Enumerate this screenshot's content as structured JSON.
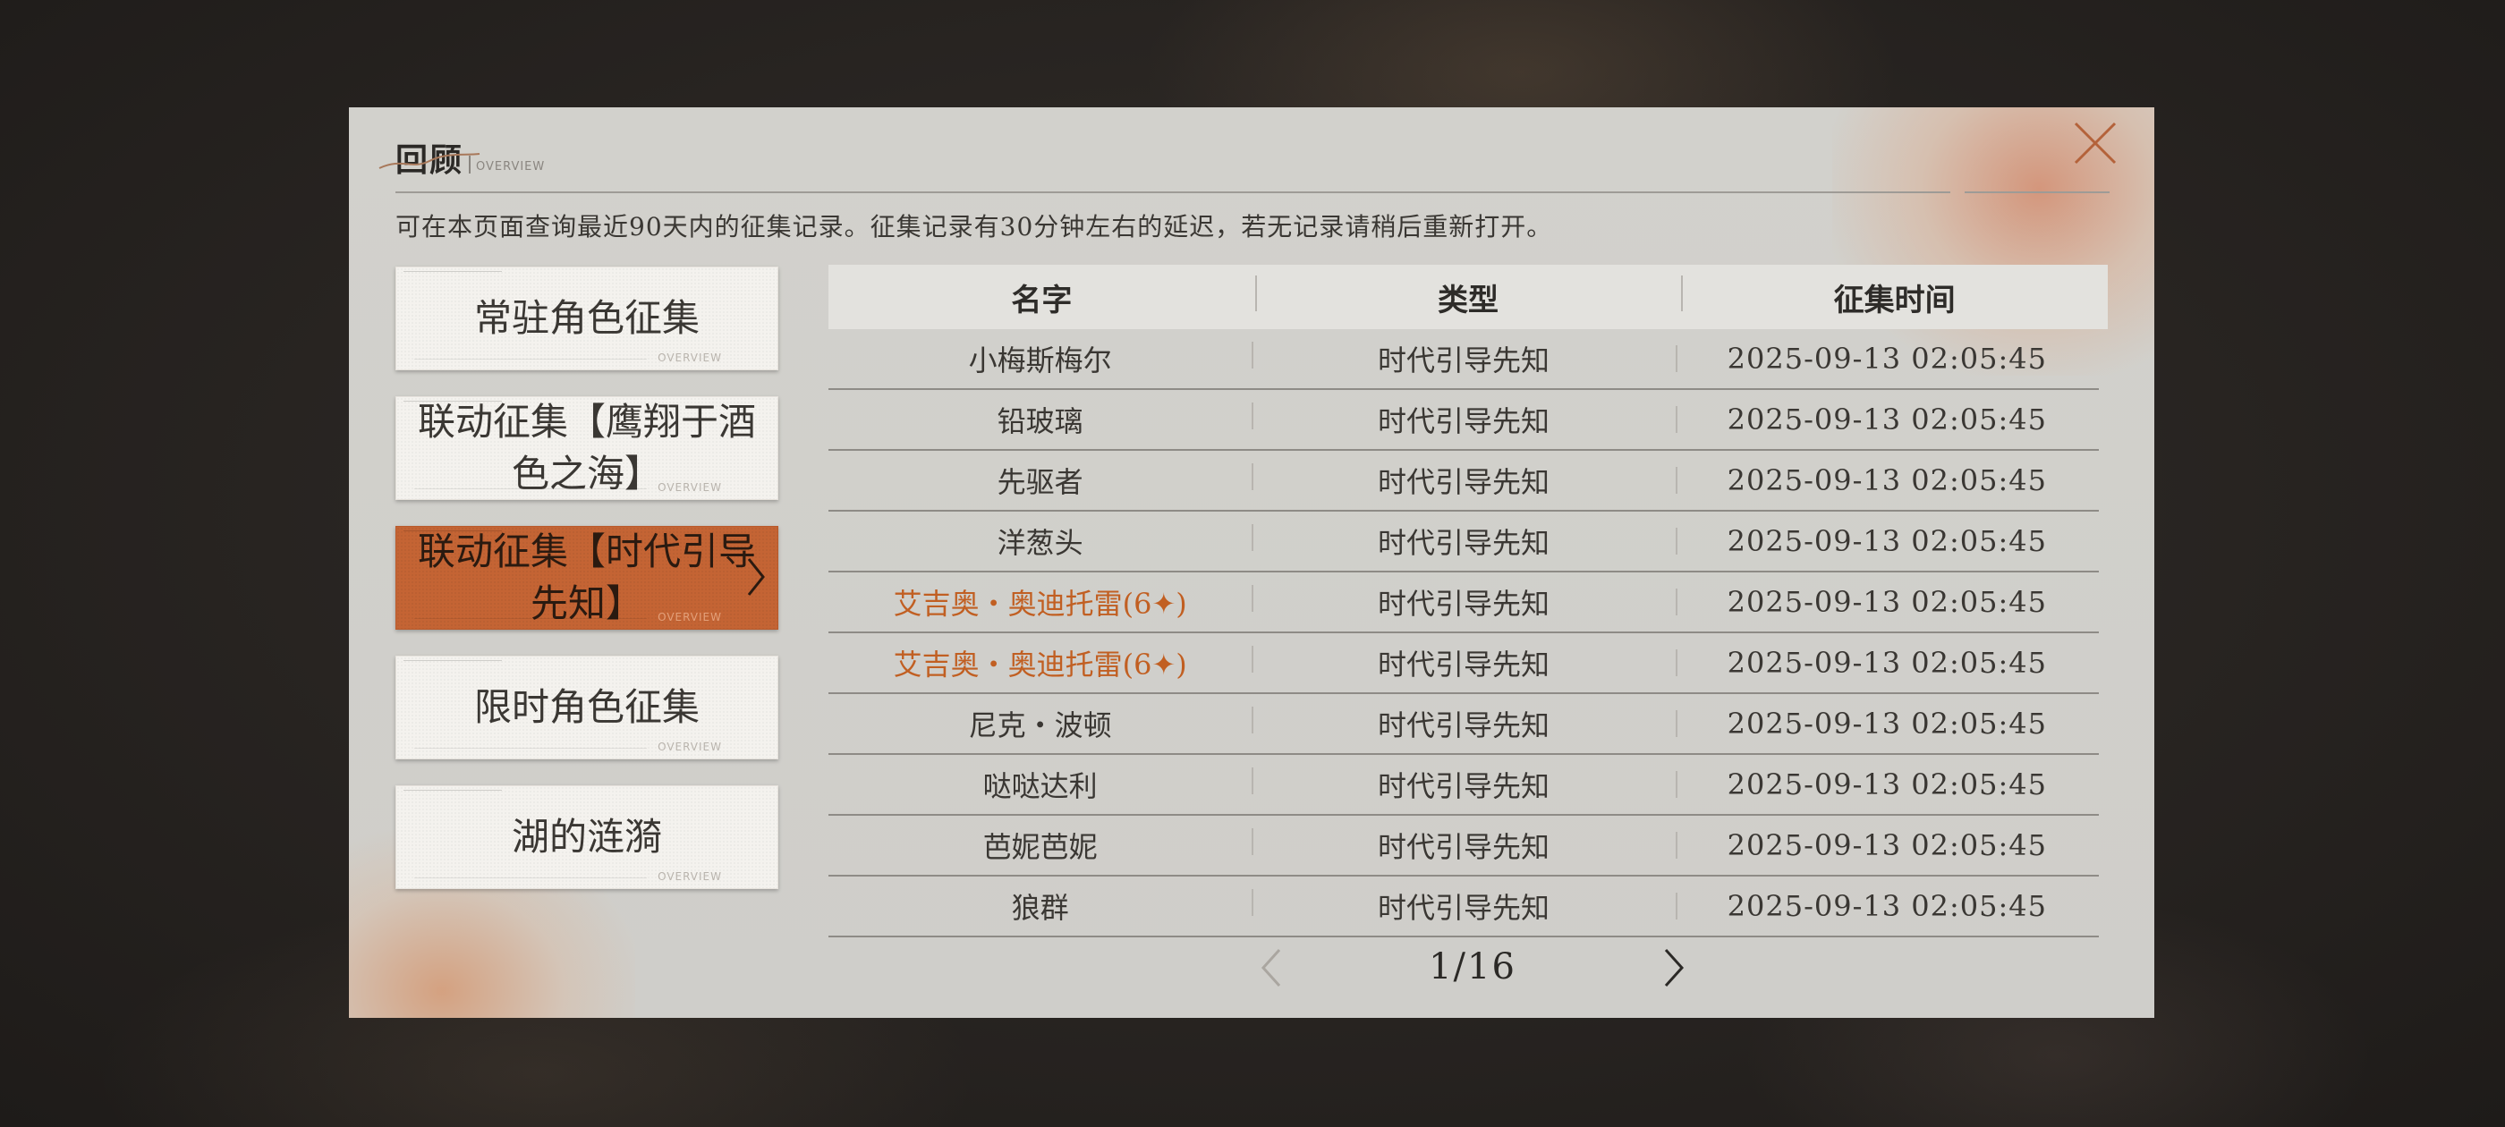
{
  "header": {
    "title": "回顾",
    "subtitle": "OVERVIEW",
    "notice": "可在本页面查询最近90天内的征集记录。征集记录有30分钟左右的延迟，若无记录请稍后重新打开。"
  },
  "sidebar": {
    "tab_footer": "OVERVIEW",
    "tabs": [
      {
        "label": "常驻角色征集",
        "active": false
      },
      {
        "label": "联动征集【鹰翔于酒色之海】",
        "active": false
      },
      {
        "label": "联动征集【时代引导先知】",
        "active": true
      },
      {
        "label": "限时角色征集",
        "active": false
      },
      {
        "label": "湖的涟漪",
        "active": false
      }
    ]
  },
  "table": {
    "headers": [
      "名字",
      "类型",
      "征集时间"
    ],
    "rows": [
      {
        "name": "小梅斯梅尔",
        "type": "时代引导先知",
        "time": "2025-09-13 02:05:45",
        "highlight": false
      },
      {
        "name": "铅玻璃",
        "type": "时代引导先知",
        "time": "2025-09-13 02:05:45",
        "highlight": false
      },
      {
        "name": "先驱者",
        "type": "时代引导先知",
        "time": "2025-09-13 02:05:45",
        "highlight": false
      },
      {
        "name": "洋葱头",
        "type": "时代引导先知",
        "time": "2025-09-13 02:05:45",
        "highlight": false
      },
      {
        "name": "艾吉奥・奥迪托雷(6✦)",
        "type": "时代引导先知",
        "time": "2025-09-13 02:05:45",
        "highlight": true
      },
      {
        "name": "艾吉奥・奥迪托雷(6✦)",
        "type": "时代引导先知",
        "time": "2025-09-13 02:05:45",
        "highlight": true
      },
      {
        "name": "尼克・波顿",
        "type": "时代引导先知",
        "time": "2025-09-13 02:05:45",
        "highlight": false
      },
      {
        "name": "哒哒达利",
        "type": "时代引导先知",
        "time": "2025-09-13 02:05:45",
        "highlight": false
      },
      {
        "name": "芭妮芭妮",
        "type": "时代引导先知",
        "time": "2025-09-13 02:05:45",
        "highlight": false
      },
      {
        "name": "狼群",
        "type": "时代引导先知",
        "time": "2025-09-13 02:05:45",
        "highlight": false
      }
    ]
  },
  "pager": {
    "current": "1",
    "total": "16",
    "display": "1/16"
  },
  "colors": {
    "accent": "#c46434",
    "highlight_text": "#c15f22",
    "panel_bg": "#d2d1cc"
  },
  "icons": {
    "close": "close-icon",
    "prev": "chevron-left-icon",
    "next": "chevron-right-icon",
    "active_tab_arrow": "chevron-right-icon"
  }
}
